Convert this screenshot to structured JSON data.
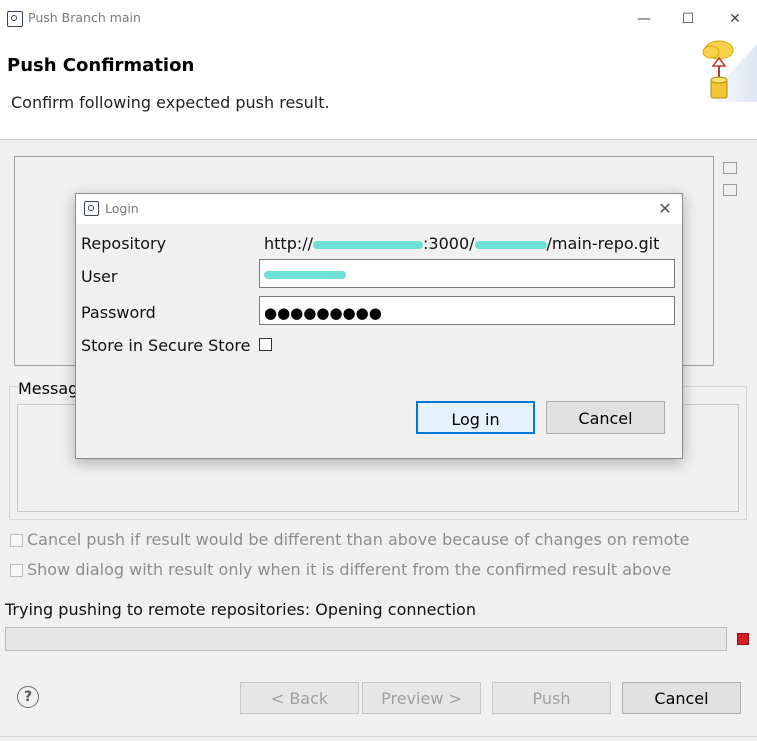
{
  "window": {
    "title": "Push Branch main",
    "minimize": "—",
    "maximize": "☐",
    "close": "✕"
  },
  "header": {
    "title": "Push Confirmation",
    "description": "Confirm following expected push result."
  },
  "message_label": "Messag",
  "checkboxes": [
    {
      "label": "Cancel push if result would be different than above because of changes on remote",
      "checked": false
    },
    {
      "label": "Show dialog with result only when it is different from the confirmed result above",
      "checked": false
    }
  ],
  "status_text": "Trying pushing to remote repositories: Opening connection",
  "buttons": {
    "back": "< Back",
    "preview": "Preview >",
    "push": "Push",
    "cancel": "Cancel"
  },
  "help": "?",
  "login": {
    "title": "Login",
    "close": "✕",
    "repository_label": "Repository",
    "repository_prefix": "http://",
    "repository_mid": ":3000/",
    "repository_suffix": "/main-repo.git",
    "user_label": "User",
    "password_label": "Password",
    "password_mask": "●●●●●●●●●",
    "store_label": "Store in Secure Store",
    "store_checked": false,
    "login_button": "Log in",
    "cancel_button": "Cancel"
  },
  "colors": {
    "accent": "#0078d7",
    "stop": "#d41f26",
    "redaction": "#6ee0d5"
  }
}
